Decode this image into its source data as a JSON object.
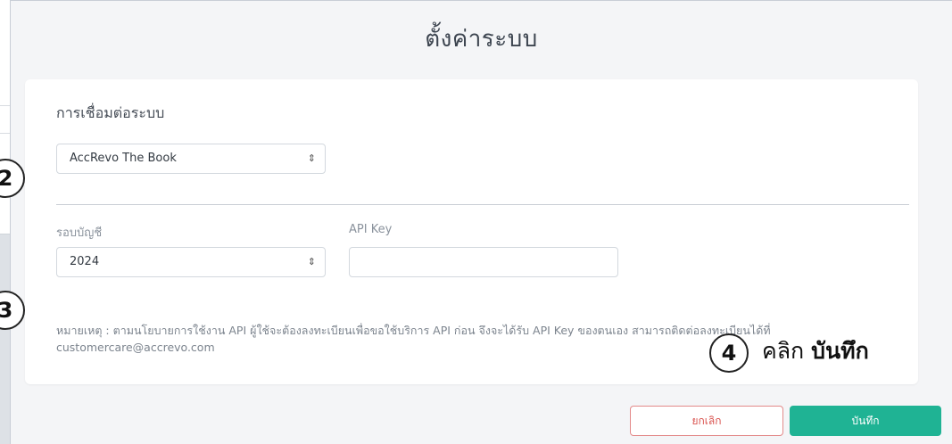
{
  "modal": {
    "title": "ตั้งค่าระบบ",
    "section_title": "การเชื่อมต่อระบบ",
    "system_select": {
      "value": "AccRevo The Book"
    },
    "period": {
      "label": "รอบบัญชี",
      "value": "2024"
    },
    "api_key": {
      "label": "API Key",
      "value": ""
    },
    "note": "หมายเหตุ : ตามนโยบายการใช้งาน API ผู้ใช้จะต้องลงทะเบียนเพื่อขอใช้บริการ API ก่อน จึงจะได้รับ API Key ของตนเอง สามารถติดต่อลงทะเบียนได้ที่ customercare@accrevo.com",
    "cancel_label": "ยกเลิก",
    "save_label": "บันทึก"
  },
  "overlay": {
    "step2": "2",
    "step3": "3",
    "step4": "4",
    "step4_text": "คลิก",
    "step4_bold": "บันทึก"
  },
  "colors": {
    "save_button": "#1fb394",
    "cancel_border": "#e38a8a"
  }
}
